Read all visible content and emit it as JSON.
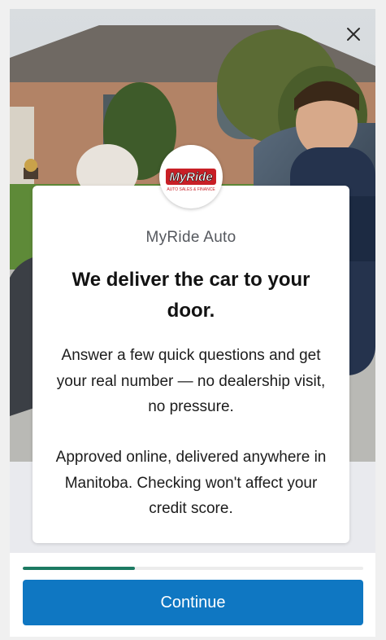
{
  "modal": {
    "brand_name": "MyRide Auto",
    "logo_text": "MyRide",
    "logo_tagline": "AUTO SALES & FINANCE",
    "headline": "We deliver the car to your door.",
    "body_paragraph_1": "Answer a few quick questions and get your real number — no dealership visit, no pressure.",
    "body_paragraph_2": "Approved online, delivered anywhere in Manitoba. Checking won't affect your credit score.",
    "close_icon": "close-icon"
  },
  "progress": {
    "fraction": 0.33,
    "color": "#1c7a62"
  },
  "footer": {
    "continue_label": "Continue",
    "button_color": "#0f77c2"
  },
  "hero": {
    "description_icon": "photo"
  }
}
